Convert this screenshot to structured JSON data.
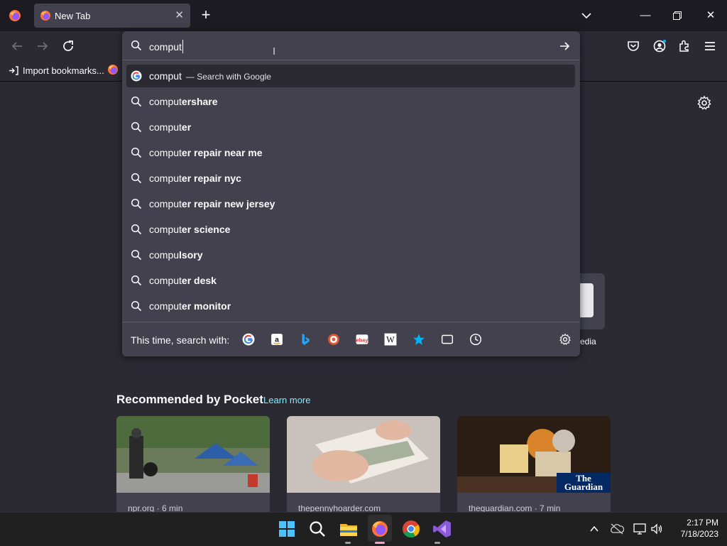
{
  "browser": {
    "tab_title": "New Tab",
    "bookmarks_import": "Import bookmarks...",
    "urlbar_value": "comput"
  },
  "suggestions": [
    {
      "prefix": "comput",
      "bold": "",
      "action": "— Search with Google",
      "icon": "google-icon"
    },
    {
      "prefix": "comput",
      "bold": "ershare",
      "action": "",
      "icon": "search-icon"
    },
    {
      "prefix": "comput",
      "bold": "er",
      "action": "",
      "icon": "search-icon"
    },
    {
      "prefix": "comput",
      "bold": "er repair near me",
      "action": "",
      "icon": "search-icon"
    },
    {
      "prefix": "comput",
      "bold": "er repair nyc",
      "action": "",
      "icon": "search-icon"
    },
    {
      "prefix": "comput",
      "bold": "er repair new jersey",
      "action": "",
      "icon": "search-icon"
    },
    {
      "prefix": "comput",
      "bold": "er science",
      "action": "",
      "icon": "search-icon"
    },
    {
      "prefix": "compu",
      "bold": "lsory",
      "action": "",
      "icon": "search-icon"
    },
    {
      "prefix": "comput",
      "bold": "er desk",
      "action": "",
      "icon": "search-icon"
    },
    {
      "prefix": "comput",
      "bold": "er monitor",
      "action": "",
      "icon": "search-icon"
    }
  ],
  "one_offs": {
    "label": "This time, search with:",
    "engines": [
      "google-icon",
      "amazon-icon",
      "bing-icon",
      "duckduckgo-icon",
      "ebay-icon",
      "wikipedia-icon",
      "bookmarks-star-icon",
      "tabs-icon",
      "history-icon"
    ]
  },
  "shortcut_partial_label": "edia",
  "pocket": {
    "title": "Recommended by Pocket",
    "learn_more": "Learn more",
    "cards": [
      {
        "source": "npr.org · 6 min"
      },
      {
        "source": "thepennyhoarder.com"
      },
      {
        "source": "theguardian.com · 7 min"
      }
    ],
    "guardian_logo": "The Guardian"
  },
  "taskbar": {
    "time": "2:17 PM",
    "date": "7/18/2023"
  },
  "colors": {
    "accent": "#80ebff",
    "popup_bg": "#42414d",
    "toolbar_bg": "#2b2a33",
    "frame_bg": "#1c1b22"
  }
}
